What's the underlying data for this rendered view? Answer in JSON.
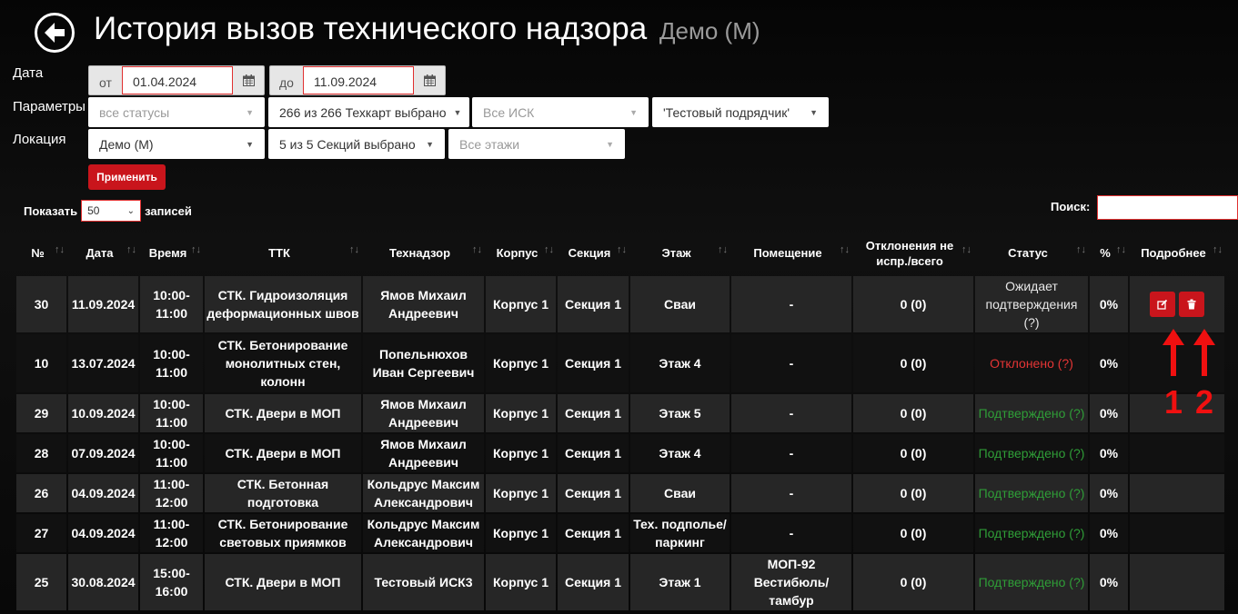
{
  "header": {
    "title": "История вызов технического надзора",
    "subtitle": "Демо (М)"
  },
  "filters": {
    "date_label": "Дата",
    "params_label": "Параметры",
    "location_label": "Локация",
    "from_prefix": "от",
    "from_value": "01.04.2024",
    "to_prefix": "до",
    "to_value": "11.09.2024",
    "status_select": "все статусы",
    "techcards_select": "266 из 266 Техкарт выбрано",
    "isk_select": "Все ИСК",
    "contractor_select": "'Тестовый подрядчик'",
    "location_select": "Демо (М)",
    "sections_select": "5 из 5 Секций выбрано",
    "floors_select": "Все этажи",
    "apply_label": "Применить"
  },
  "list_controls": {
    "show_label": "Показать",
    "page_size": "50",
    "records_label": "записей",
    "search_label": "Поиск:"
  },
  "table": {
    "columns": [
      "№",
      "Дата",
      "Время",
      "ТТК",
      "Технадзор",
      "Корпус",
      "Секция",
      "Этаж",
      "Помещение",
      "Отклонения не испр./всего",
      "Статус",
      "%",
      "Подробнее"
    ],
    "rows": [
      {
        "id": "30",
        "date": "11.09.2024",
        "time": "10:00-11:00",
        "ttk": "СТК. Гидроизоляция деформационных швов",
        "inspector": "Ямов Михаил Андреевич",
        "building": "Корпус 1",
        "section": "Секция 1",
        "floor": "Сваи",
        "room": "-",
        "deviations": "0 (0)",
        "status": "Ожидает подтверждения (?)",
        "status_type": "pending",
        "percent": "0%",
        "actions": true
      },
      {
        "id": "10",
        "date": "13.07.2024",
        "time": "10:00-11:00",
        "ttk": "СТК. Бетонирование монолитных стен, колонн",
        "inspector": "Попельнюхов Иван Сергеевич",
        "building": "Корпус 1",
        "section": "Секция 1",
        "floor": "Этаж 4",
        "room": "-",
        "deviations": "0 (0)",
        "status": "Отклонено (?)",
        "status_type": "rejected",
        "percent": "0%",
        "actions": false
      },
      {
        "id": "29",
        "date": "10.09.2024",
        "time": "10:00-11:00",
        "ttk": "СТК. Двери в МОП",
        "inspector": "Ямов Михаил Андреевич",
        "building": "Корпус 1",
        "section": "Секция 1",
        "floor": "Этаж 5",
        "room": "-",
        "deviations": "0 (0)",
        "status": "Подтверждено (?)",
        "status_type": "ok",
        "percent": "0%",
        "actions": false
      },
      {
        "id": "28",
        "date": "07.09.2024",
        "time": "10:00-11:00",
        "ttk": "СТК. Двери в МОП",
        "inspector": "Ямов Михаил Андреевич",
        "building": "Корпус 1",
        "section": "Секция 1",
        "floor": "Этаж 4",
        "room": "-",
        "deviations": "0 (0)",
        "status": "Подтверждено (?)",
        "status_type": "ok",
        "percent": "0%",
        "actions": false
      },
      {
        "id": "26",
        "date": "04.09.2024",
        "time": "11:00-12:00",
        "ttk": "СТК. Бетонная подготовка",
        "inspector": "Кольдрус Максим Александрович",
        "building": "Корпус 1",
        "section": "Секция 1",
        "floor": "Сваи",
        "room": "-",
        "deviations": "0 (0)",
        "status": "Подтверждено (?)",
        "status_type": "ok",
        "percent": "0%",
        "actions": false
      },
      {
        "id": "27",
        "date": "04.09.2024",
        "time": "11:00-12:00",
        "ttk": "СТК. Бетонирование световых приямков",
        "inspector": "Кольдрус Максим Александрович",
        "building": "Корпус 1",
        "section": "Секция 1",
        "floor": "Тех. подполье/ паркинг",
        "room": "-",
        "deviations": "0 (0)",
        "status": "Подтверждено (?)",
        "status_type": "ok",
        "percent": "0%",
        "actions": false
      },
      {
        "id": "25",
        "date": "30.08.2024",
        "time": "15:00-16:00",
        "ttk": "СТК. Двери в МОП",
        "inspector": "Тестовый ИСК3",
        "building": "Корпус 1",
        "section": "Секция 1",
        "floor": "Этаж 1",
        "room": "МОП-92 Вестибюль/ тамбур",
        "deviations": "0 (0)",
        "status": "Подтверждено (?)",
        "status_type": "ok",
        "percent": "0%",
        "actions": false
      }
    ]
  },
  "annotations": {
    "label_1": "1",
    "label_2": "2"
  },
  "icons": {
    "back": "arrow-left-circle-icon",
    "calendar": "calendar-icon",
    "edit": "edit-icon",
    "delete": "trash-icon",
    "sort": "sort-icon"
  },
  "colors": {
    "accent": "#c9151c",
    "rejected": "#e53535",
    "confirmed": "#2f9d37",
    "annotation": "#f01010"
  }
}
